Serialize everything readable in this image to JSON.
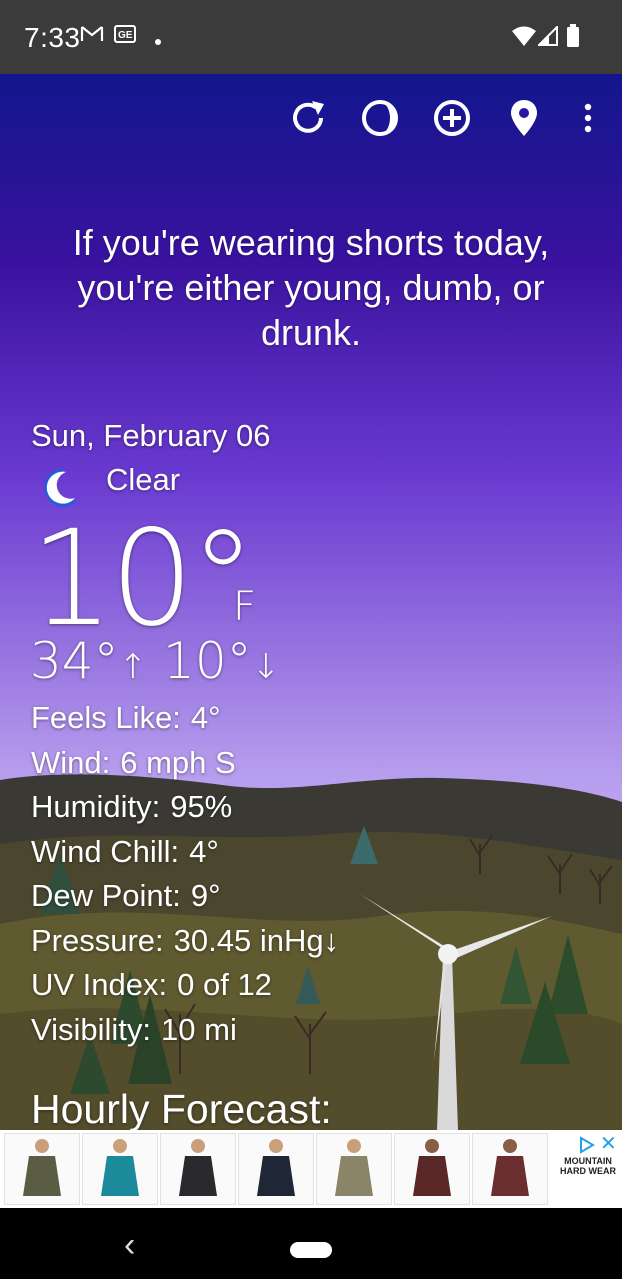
{
  "status_bar": {
    "time": "7:33",
    "icons": [
      "gmail-icon",
      "news-icon",
      "dot-icon",
      "wifi-icon",
      "signal-icon",
      "battery-icon"
    ]
  },
  "toolbar": {
    "buttons": [
      "refresh-icon",
      "theme-icon",
      "add-icon",
      "location-icon",
      "more-icon"
    ]
  },
  "quote": "If you're wearing shorts today, you're either young, dumb, or drunk.",
  "weather": {
    "date": "Sun, February 06",
    "condition": "Clear",
    "condition_icon": "moon-icon",
    "temperature": "10°",
    "unit": "F",
    "high": "34°",
    "low": "10°",
    "up_arrow": "↑",
    "down_arrow": "↓",
    "details": [
      {
        "label": "Feels Like:",
        "value": "4°"
      },
      {
        "label": "Wind:",
        "value": "6 mph S"
      },
      {
        "label": "Humidity:",
        "value": "95%"
      },
      {
        "label": "Wind Chill:",
        "value": "4°"
      },
      {
        "label": "Dew Point:",
        "value": "9°"
      },
      {
        "label": "Pressure:",
        "value": "30.45 inHg↓"
      },
      {
        "label": "UV Index:",
        "value": "0 of 12"
      },
      {
        "label": "Visibility:",
        "value": "10 mi"
      }
    ]
  },
  "hourly_title": "Hourly Forecast:",
  "ad": {
    "jacket_colors": [
      "#5a5c44",
      "#1b8a9a",
      "#2a2a2e",
      "#1f2736",
      "#8a8468",
      "#5a2826",
      "#6a2e2e"
    ],
    "brand": "MOUNTAIN HARD WEAR",
    "close": "✕"
  },
  "nav": {
    "back": "‹"
  },
  "colors": {
    "sky_top": "#12168d",
    "sky_bottom": "#c1a8f0",
    "hill": "#3b3934",
    "grass": "#5f5a30"
  }
}
